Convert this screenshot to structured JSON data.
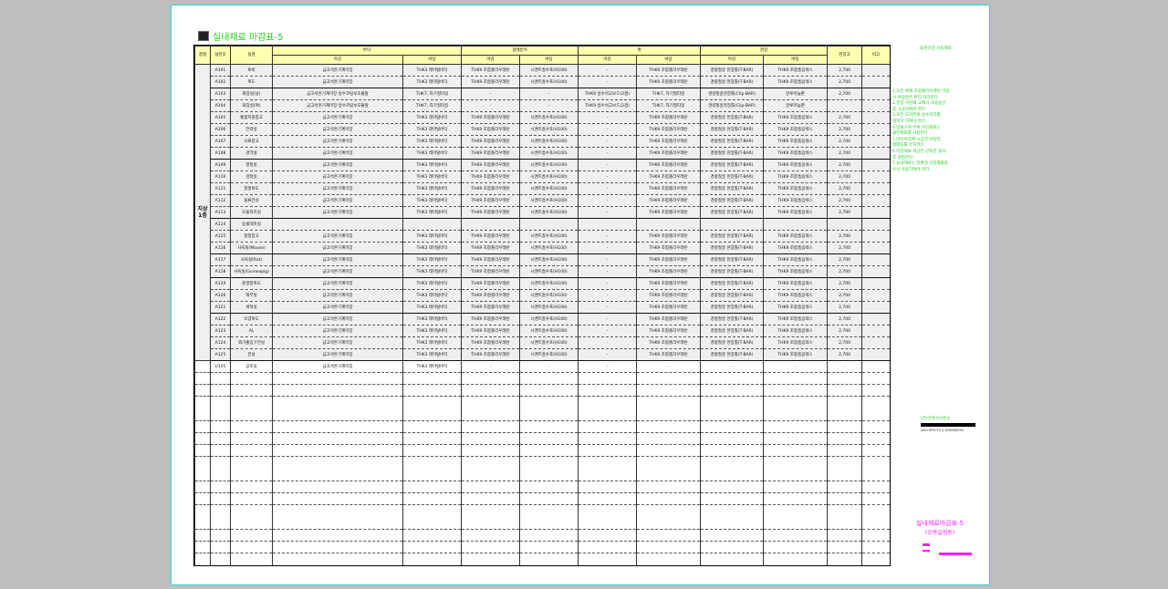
{
  "sheet": {
    "title": "실내재료 마감표-5",
    "title_icon": "window-icon"
  },
  "table": {
    "header": {
      "zone": "층별",
      "room_no": "실번호",
      "room_name": "실명",
      "floor": "바닥",
      "floor_main": "마감",
      "floor_base": "바탕",
      "baseboard": "걸레받이",
      "baseboard_main": "마감",
      "baseboard_base": "바탕",
      "wall": "벽",
      "wall_main": "마감",
      "wall_base": "바탕",
      "ceiling": "천장",
      "ceiling_main": "마감",
      "ceiling_base": "바탕",
      "height": "천장고",
      "remark": "비고"
    },
    "zone_label": "지상 1층",
    "rows": [
      {
        "no": "A101",
        "name": "로비",
        "fm": "금고석흔기계미장",
        "fb": "THK3 레미탈바닥",
        "bm": "THK9 조합폴리우레탄",
        "bb": "시멘트흡수포(H100)",
        "wm": "-",
        "wb": "THK9 조합폴리우레탄",
        "cm": "경량철골 천장틀(T-BAR)",
        "cb": "THK9 조합흡음텍스",
        "h": "2,700",
        "sep": false
      },
      {
        "no": "A102",
        "name": "복도",
        "fm": "금고석흔기계미장",
        "fb": "THK3 레미탈바닥",
        "bm": "THK9 조합폴리우레탄",
        "bb": "시멘트흡수포(H100)",
        "wm": "-",
        "wb": "THK9 조합폴리우레탄",
        "cm": "경량철골 천장틀(T-BAR)",
        "cb": "THK9 조합흡음텍스",
        "h": "2,700",
        "sep": true
      },
      {
        "no": "A103",
        "name": "화장실(남)",
        "fm": "금고석흔기계미장 방수코팅보호몰탈",
        "fb": "THK7, 자기질타일",
        "bm": "-",
        "bb": "-",
        "wm": "THK9 방수석고보드(2겹)",
        "wb": "THK7, 자기질타일",
        "cm": "경량철골천장틀(Clip-BAR)",
        "cb": "알루미늄판",
        "h": "2,700",
        "sep": false
      },
      {
        "no": "A104",
        "name": "화장실(여)",
        "fm": "금고석흔기계미장 방수코팅보호몰탈",
        "fb": "THK7, 자기질타일",
        "bm": "-",
        "bb": "-",
        "wm": "THK9 방수석고보드(2겹)",
        "wb": "THK7, 자기질타일",
        "cm": "경량철골천장틀(Clip-BAR)",
        "cb": "알루미늄판",
        "h": "",
        "sep": false
      },
      {
        "no": "A105",
        "name": "통합지원창고",
        "fm": "금고석흔기계미장",
        "fb": "THK3 레미탈바닥",
        "bm": "THK9 조합폴리우레탄",
        "bb": "시멘트흡수포(H100)",
        "wm": "-",
        "wb": "THK9 조합폴리우레탄",
        "cm": "경량철골 천장틀(T-BAR)",
        "cb": "THK9 조합흡음텍스",
        "h": "2,700",
        "sep": false
      },
      {
        "no": "A106",
        "name": "전력실",
        "fm": "금고석흔기계미장",
        "fb": "THK3 레미탈바닥",
        "bm": "THK9 조합폴리우레탄",
        "bb": "시멘트흡수포(H100)",
        "wm": "-",
        "wb": "THK9 조합폴리우레탄",
        "cm": "경량철골 천장틀(T-BAR)",
        "cb": "THK9 조합흡음텍스",
        "h": "2,700",
        "sep": false
      },
      {
        "no": "A107",
        "name": "사료창고",
        "fm": "금고석흔기계미장",
        "fb": "THK3 레미탈바닥",
        "bm": "THK9 조합폴리우레탄",
        "bb": "시멘트흡수포(H100)",
        "wm": "-",
        "wb": "THK9 조합폴리우레탄",
        "cm": "경량철골 천장틀(T-BAR)",
        "cb": "THK9 조합흡음텍스",
        "h": "2,700",
        "sep": false
      },
      {
        "no": "A108",
        "name": "검역실",
        "fm": "금고석흔기계미장",
        "fb": "THK3 레미탈바닥",
        "bm": "THK9 조합폴리우레탄",
        "bb": "시멘트흡수포(H100)",
        "wm": "-",
        "wb": "THK9 조합폴리우레탄",
        "cm": "경량철골 천장틀(T-BAR)",
        "cb": "THK9 조합흡음텍스",
        "h": "2,700",
        "sep": true
      },
      {
        "no": "A109",
        "name": "청정실",
        "fm": "금고석흔기계미장",
        "fb": "THK3 레미탈바닥",
        "bm": "THK9 조합폴리우레탄",
        "bb": "시멘트흡수포(H100)",
        "wm": "-",
        "wb": "THK9 조합폴리우레탄",
        "cm": "경량철골 천장틀(T-BAR)",
        "cb": "THK9 조합흡음텍스",
        "h": "2,700",
        "sep": false
      },
      {
        "no": "A110",
        "name": "검정실",
        "fm": "금고석흔기계미장",
        "fb": "THK3 레미탈바닥",
        "bm": "THK9 조합폴리우레탄",
        "bb": "시멘트흡수포(H100)",
        "wm": "-",
        "wb": "THK9 조합폴리우레탄",
        "cm": "경량철골 천장틀(T-BAR)",
        "cb": "THK9 조합흡음텍스",
        "h": "2,700",
        "sep": false
      },
      {
        "no": "A111",
        "name": "청정복도",
        "fm": "금고석흔기계미장",
        "fb": "THK3 레미탈바닥",
        "bm": "THK9 조합폴리우레탄",
        "bb": "시멘트흡수포(H100)",
        "wm": "-",
        "wb": "THK9 조합폴리우레탄",
        "cm": "경량철골 천장틀(T-BAR)",
        "cb": "THK9 조합흡음텍스",
        "h": "2,700",
        "sep": false
      },
      {
        "no": "A112",
        "name": "물류전실",
        "fm": "금고석흔기계미장",
        "fb": "THK3 레미탈바닥",
        "bm": "THK9 조합폴리우레탄",
        "bb": "시멘트흡수포(H100)",
        "wm": "-",
        "wb": "THK9 조합폴리우레탄",
        "cm": "경량철골 천장틀(T-BAR)",
        "cb": "THK9 조합흡음텍스",
        "h": "2,700",
        "sep": false
      },
      {
        "no": "A113",
        "name": "오물처리실",
        "fm": "금고석흔기계미장",
        "fb": "THK3 레미탈바닥",
        "bm": "THK9 조합폴리우레탄",
        "bb": "시멘트흡수포(H100)",
        "wm": "-",
        "wb": "THK9 조합폴리우레탄",
        "cm": "경량철골 천장틀(T-BAR)",
        "cb": "THK9 조합흡음텍스",
        "h": "2,700",
        "sep": true
      },
      {
        "no": "A114",
        "name": "동물대피실",
        "fm": "",
        "fb": "",
        "bm": "",
        "bb": "",
        "wm": "",
        "wb": "",
        "cm": "",
        "cb": "",
        "h": "",
        "sep": false
      },
      {
        "no": "A115",
        "name": "청정창고",
        "fm": "금고석흔기계미장",
        "fb": "THK3 레미탈바닥",
        "bm": "THK9 조합폴리우레탄",
        "bb": "시멘트흡수포(H100)",
        "wm": "-",
        "wb": "THK9 조합폴리우레탄",
        "cm": "경량철골 천장틀(T-BAR)",
        "cb": "THK9 조합흡음텍스",
        "h": "2,700",
        "sep": false
      },
      {
        "no": "A116",
        "name": "사육실(Mouse)",
        "fm": "금고석흔기계미장",
        "fb": "THK3 레미탈바닥",
        "bm": "THK9 조합폴리우레탄",
        "bb": "시멘트흡수포(H100)",
        "wm": "-",
        "wb": "THK9 조합폴리우레탄",
        "cm": "경량철골 천장틀(T-BAR)",
        "cb": "THK9 조합흡음텍스",
        "h": "2,700",
        "sep": true
      },
      {
        "no": "A117",
        "name": "사육실(Rat)",
        "fm": "금고석흔기계미장",
        "fb": "THK3 레미탈바닥",
        "bm": "THK9 조합폴리우레탄",
        "bb": "시멘트흡수포(H100)",
        "wm": "-",
        "wb": "THK9 조합폴리우레탄",
        "cm": "경량철골 천장틀(T-BAR)",
        "cb": "THK9 조합흡음텍스",
        "h": "2,700",
        "sep": false
      },
      {
        "no": "A118",
        "name": "사육실(Guineapig)",
        "fm": "금고석흔기계미장",
        "fb": "THK3 레미탈바닥",
        "bm": "THK9 조합폴리우레탄",
        "bb": "시멘트흡수포(H100)",
        "wm": "-",
        "wb": "THK9 조합폴리우레탄",
        "cm": "경량철골 천장틀(T-BAR)",
        "cb": "THK9 조합흡음텍스",
        "h": "2,700",
        "sep": true
      },
      {
        "no": "A119",
        "name": "준청정복도",
        "fm": "금고석흔기계미장",
        "fb": "THK3 레미탈바닥",
        "bm": "THK9 조합폴리우레탄",
        "bb": "시멘트흡수포(H100)",
        "wm": "-",
        "wb": "THK9 조합폴리우레탄",
        "cm": "경량철골 천장틀(T-BAR)",
        "cb": "THK9 조합흡음텍스",
        "h": "2,700",
        "sep": false
      },
      {
        "no": "A120",
        "name": "해부실",
        "fm": "금고석흔기계미장",
        "fb": "THK3 레미탈바닥",
        "bm": "THK9 조합폴리우레탄",
        "bb": "시멘트흡수포(H100)",
        "wm": "-",
        "wb": "THK9 조합폴리우레탄",
        "cm": "경량철골 천장틀(T-BAR)",
        "cb": "THK9 조합흡음텍스",
        "h": "2,700",
        "sep": false
      },
      {
        "no": "A121",
        "name": "세척실",
        "fm": "금고석흔기계미장",
        "fb": "THK3 레미탈바닥",
        "bm": "THK9 조합폴리우레탄",
        "bb": "시멘트흡수포(H100)",
        "wm": "-",
        "wb": "THK9 조합폴리우레탄",
        "cm": "경량철골 천장틀(T-BAR)",
        "cb": "THK9 조합흡음텍스",
        "h": "2,700",
        "sep": true
      },
      {
        "no": "A122",
        "name": "오염복도",
        "fm": "금고석흔기계미장",
        "fb": "THK3 레미탈바닥",
        "bm": "THK9 조합폴리우레탄",
        "bb": "시멘트흡수포(H100)",
        "wm": "-",
        "wb": "THK9 조합폴리우레탄",
        "cm": "경량철골 천장틀(T-BAR)",
        "cb": "THK9 조합흡음텍스",
        "h": "2,700",
        "sep": false
      },
      {
        "no": "A123",
        "name": "AL",
        "fm": "금고석흔기계미장",
        "fb": "THK3 레미탈바닥",
        "bm": "THK9 조합폴리우레탄",
        "bb": "시멘트흡수포(H100)",
        "wm": "-",
        "wb": "THK9 조합폴리우레탄",
        "cm": "경량철골 천장틀(T-BAR)",
        "cb": "THK9 조합흡음텍스",
        "h": "2,700",
        "sep": false
      },
      {
        "no": "A124",
        "name": "외기출입구전실",
        "fm": "금고석흔기계미장",
        "fb": "THK3 레미탈바닥",
        "bm": "THK9 조합폴리우레탄",
        "bb": "시멘트흡수포(H100)",
        "wm": "-",
        "wb": "THK9 조합폴리우레탄",
        "cm": "경량철골 천장틀(T-BAR)",
        "cb": "THK9 조합흡음텍스",
        "h": "2,700",
        "sep": false
      },
      {
        "no": "A125",
        "name": "전실",
        "fm": "금고석흔기계미장",
        "fb": "THK3 레미탈바닥",
        "bm": "THK9 조합폴리우레탄",
        "bb": "시멘트흡수포(H100)",
        "wm": "-",
        "wb": "THK9 조합폴리우레탄",
        "cm": "경량철골 천장틀(T-BAR)",
        "cb": "THK9 조합흡음텍스",
        "h": "2,700",
        "sep": true
      },
      {
        "no": "U101",
        "name": "공조실",
        "fm": "금고석흔기계미장",
        "fb": "THK3 레미탈바닥",
        "bm": "-",
        "bb": "-",
        "wm": "-",
        "wb": "-",
        "cm": "-",
        "cb": "-",
        "h": "-",
        "sep": false
      }
    ]
  },
  "notes": {
    "title": "표준마감 사용재료",
    "lines": [
      "1.모든 벽체 조합폴리우레탄 마감",
      "  시 바탕면은 퍼티 처리한다",
      "2.천장 마감재 교체시 사용승인",
      "  후 시공하여야 한다",
      "3.모든 도어부위 방수처리를",
      "  철저히 하여야 한다",
      "4.방화구획 부위 마감재료는",
      "  불연재료를 사용한다",
      "5.바닥마감재 시공전 바탕면",
      "  평활도를 유지한다",
      "6.마감재료 색상은 감독관 협의",
      "  후 결정한다",
      "7.실내재료는 친환경 인증제품을",
      "  우선 사용하여야 한다"
    ]
  },
  "logo": {
    "name": "(주)건축사사무소",
    "sub": "ARCHITECTS & ENGINEERS"
  },
  "drawing": {
    "title": "실내재료마감표-5",
    "subtitle": "(공용실험동)"
  },
  "colors": {
    "header_fill": "#ffffb0",
    "row_fill": "#efefef",
    "note_text": "#22cc22",
    "title_block": "#ee22ee",
    "frame": "#2fd4d4"
  }
}
